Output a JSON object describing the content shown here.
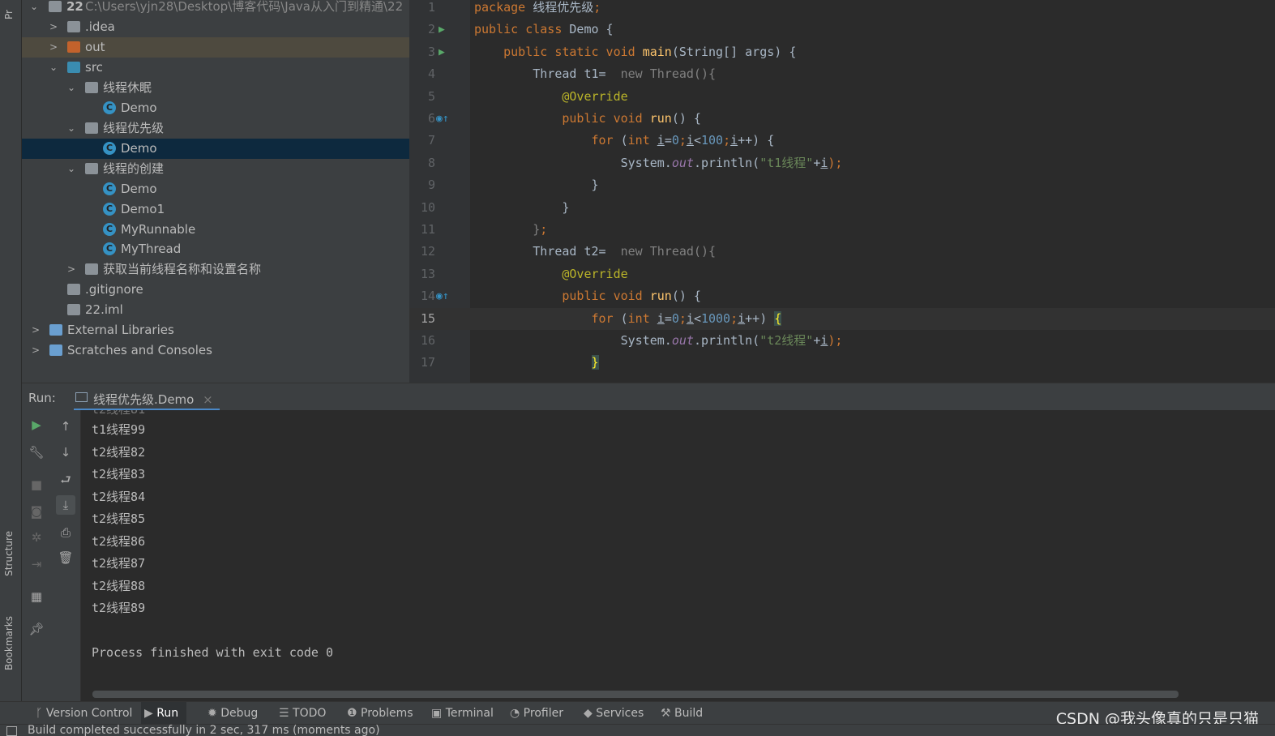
{
  "left_strip": {
    "project_label": "Pr",
    "structure_label": "Structure",
    "bookmarks_label": "Bookmarks"
  },
  "project": {
    "root": {
      "name": "22",
      "path": "C:\\Users\\yjn28\\Desktop\\博客代码\\Java从入门到精通\\22"
    },
    "items": [
      {
        "label": ".idea",
        "type": "folder"
      },
      {
        "label": "out",
        "type": "folder-out"
      },
      {
        "label": "src",
        "type": "folder-src"
      },
      {
        "label": "线程休眠",
        "type": "package"
      },
      {
        "label": "Demo",
        "type": "class-run"
      },
      {
        "label": "线程优先级",
        "type": "package"
      },
      {
        "label": "Demo",
        "type": "class-run",
        "selected": true
      },
      {
        "label": "线程的创建",
        "type": "package"
      },
      {
        "label": "Demo",
        "type": "class-run"
      },
      {
        "label": "Demo1",
        "type": "class-run"
      },
      {
        "label": "MyRunnable",
        "type": "class"
      },
      {
        "label": "MyThread",
        "type": "class-run"
      },
      {
        "label": "获取当前线程名称和设置名称",
        "type": "package"
      },
      {
        "label": ".gitignore",
        "type": "file"
      },
      {
        "label": "22.iml",
        "type": "file"
      },
      {
        "label": "External Libraries",
        "type": "libraries"
      },
      {
        "label": "Scratches and Consoles",
        "type": "scratches"
      }
    ]
  },
  "editor": {
    "current_line": 15,
    "lines": [
      [
        [
          "package ",
          "kw"
        ],
        [
          "线程优先级",
          "tx"
        ],
        [
          ";",
          "kw"
        ]
      ],
      [
        [
          "public class ",
          "kw"
        ],
        [
          "Demo {",
          "tx"
        ]
      ],
      [
        [
          "    public static void ",
          "kw"
        ],
        [
          "main",
          "fn"
        ],
        [
          "(String[] args) {",
          "tx"
        ]
      ],
      [
        [
          "        Thread t1=  ",
          "tx"
        ],
        [
          "new Thread(){",
          "gr"
        ]
      ],
      [
        [
          "            ",
          "tx"
        ],
        [
          "@Override",
          "an"
        ]
      ],
      [
        [
          "            public void ",
          "kw"
        ],
        [
          "run",
          "fn"
        ],
        [
          "() {",
          "tx"
        ]
      ],
      [
        [
          "                for ",
          "kw"
        ],
        [
          "(",
          "tx"
        ],
        [
          "int ",
          "kw"
        ],
        [
          "i",
          "ul"
        ],
        [
          "=",
          "tx"
        ],
        [
          "0",
          "nu"
        ],
        [
          ";",
          "kw"
        ],
        [
          "i",
          "ul"
        ],
        [
          "<",
          "tx"
        ],
        [
          "100",
          "nu"
        ],
        [
          ";",
          "kw"
        ],
        [
          "i",
          "ul"
        ],
        [
          "++) {",
          "tx"
        ]
      ],
      [
        [
          "                    System.",
          "tx"
        ],
        [
          "out",
          "it"
        ],
        [
          ".println(",
          "tx"
        ],
        [
          "\"t1线程\"",
          "st"
        ],
        [
          "+",
          "tx"
        ],
        [
          "i",
          "ul"
        ],
        [
          ");",
          "kw"
        ]
      ],
      [
        [
          "                }",
          "tx"
        ]
      ],
      [
        [
          "            }",
          "tx"
        ]
      ],
      [
        [
          "        }",
          "gr"
        ],
        [
          ";",
          "kw"
        ]
      ],
      [
        [
          "        Thread t2=  ",
          "tx"
        ],
        [
          "new Thread(){",
          "gr"
        ]
      ],
      [
        [
          "            ",
          "tx"
        ],
        [
          "@Override",
          "an"
        ]
      ],
      [
        [
          "            public void ",
          "kw"
        ],
        [
          "run",
          "fn"
        ],
        [
          "() {",
          "tx"
        ]
      ],
      [
        [
          "                for ",
          "kw"
        ],
        [
          "(",
          "tx"
        ],
        [
          "int ",
          "kw"
        ],
        [
          "i",
          "ul"
        ],
        [
          "=",
          "tx"
        ],
        [
          "0",
          "nu"
        ],
        [
          ";",
          "kw"
        ],
        [
          "i",
          "ul"
        ],
        [
          "<",
          "tx"
        ],
        [
          "1000",
          "nu"
        ],
        [
          ";",
          "kw"
        ],
        [
          "i",
          "ul"
        ],
        [
          "++) ",
          "tx"
        ],
        [
          "{",
          "br"
        ]
      ],
      [
        [
          "                    System.",
          "tx"
        ],
        [
          "out",
          "it"
        ],
        [
          ".println(",
          "tx"
        ],
        [
          "\"t2线程\"",
          "st"
        ],
        [
          "+",
          "tx"
        ],
        [
          "i",
          "ul"
        ],
        [
          ");",
          "kw"
        ]
      ],
      [
        [
          "                ",
          "tx"
        ],
        [
          "}",
          "br"
        ]
      ]
    ]
  },
  "run": {
    "label": "Run:",
    "tab": "线程优先级.Demo",
    "output": [
      "t1线程99",
      "t2线程82",
      "t2线程83",
      "t2线程84",
      "t2线程85",
      "t2线程86",
      "t2线程87",
      "t2线程88",
      "t2线程89",
      "",
      "Process finished with exit code 0"
    ]
  },
  "bottom_tabs": [
    {
      "label": "Version Control",
      "icon": "branch-icon"
    },
    {
      "label": "Run",
      "icon": "play-icon",
      "active": true
    },
    {
      "label": "Debug",
      "icon": "bug-icon"
    },
    {
      "label": "TODO",
      "icon": "list-icon"
    },
    {
      "label": "Problems",
      "icon": "warning-icon"
    },
    {
      "label": "Terminal",
      "icon": "terminal-icon"
    },
    {
      "label": "Profiler",
      "icon": "profiler-icon"
    },
    {
      "label": "Services",
      "icon": "services-icon"
    },
    {
      "label": "Build",
      "icon": "hammer-icon"
    }
  ],
  "status": "Build completed successfully in 2 sec, 317 ms (moments ago)",
  "watermark": "CSDN @我头像真的只是只猫"
}
